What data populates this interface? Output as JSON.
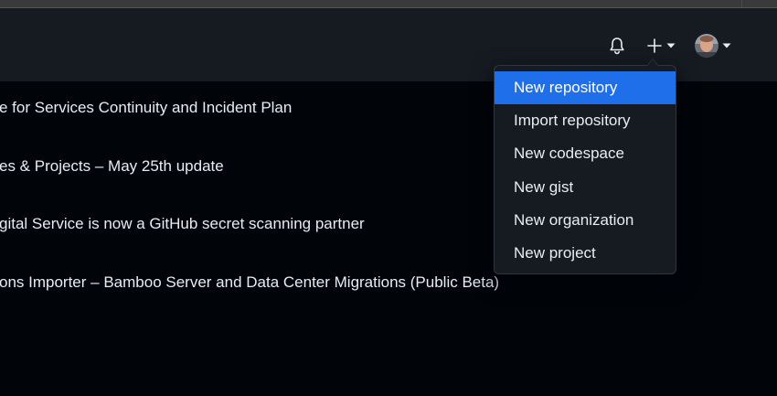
{
  "header": {
    "notifications_icon": "bell-icon",
    "create_icon": "plus-icon",
    "profile_icon": "avatar"
  },
  "create_menu": {
    "items": [
      {
        "label": "New repository",
        "active": true
      },
      {
        "label": "Import repository"
      },
      {
        "label": "New codespace"
      },
      {
        "label": "New gist"
      },
      {
        "label": "New organization"
      },
      {
        "label": "New project"
      }
    ]
  },
  "feed": {
    "items": [
      {
        "title": "e for Services Continuity and Incident Plan"
      },
      {
        "title": "es & Projects – May 25th update"
      },
      {
        "title": "gital Service is now a GitHub secret scanning partner"
      },
      {
        "title": "ons Importer – Bamboo Server and Data Center Migrations (Public Beta)"
      }
    ]
  },
  "colors": {
    "header_bg": "#161b22",
    "page_bg": "#010409",
    "menu_bg": "#161b22",
    "menu_border": "#30363d",
    "active_item": "#1f6feb",
    "text": "#e6edf3"
  }
}
